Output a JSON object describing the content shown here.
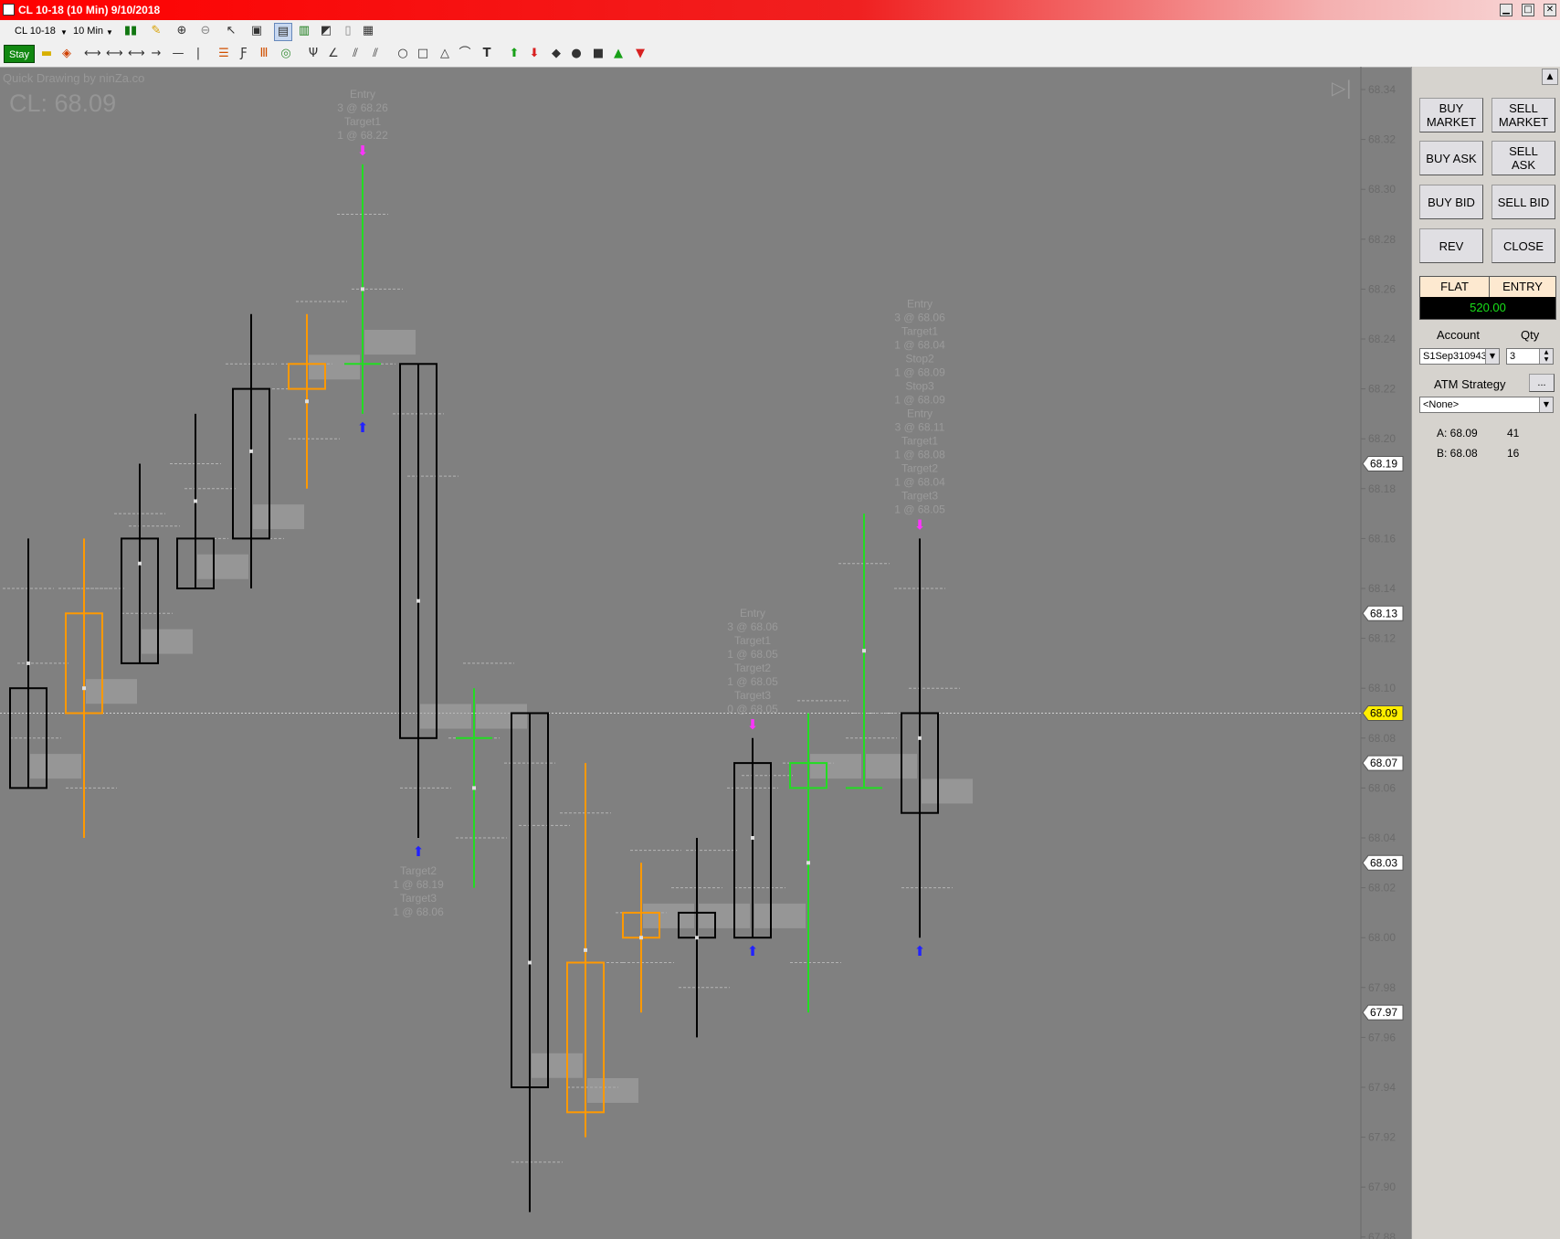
{
  "window": {
    "title": "CL 10-18 (10 Min)  9/10/2018",
    "controls": [
      "minimize",
      "maximize",
      "close"
    ]
  },
  "toolbar": {
    "instrument": "CL 10-18",
    "interval": "10 Min",
    "stay_label": "Stay",
    "icons": [
      "bar-type-icon",
      "pencil-icon",
      "zoom-in-icon",
      "zoom-out-icon",
      "pointer-icon",
      "data-box-icon",
      "chart-trader-icon",
      "indicators-icon",
      "strategies-icon",
      "properties-icon",
      "templates-icon"
    ],
    "drawing_tools": [
      "ruler-icon",
      "risk-reward-icon",
      "ray-icon",
      "extended-line-icon",
      "arrow-line-icon",
      "horizontal-line-icon",
      "vertical-line-icon",
      "fibonacci-retracement-icon",
      "fibonacci-extension-icon",
      "fibonacci-time-icon",
      "fibonacci-circle-icon",
      "andrews-pitchfork-icon",
      "gann-fan-icon",
      "regression-channel-icon",
      "trend-channel-icon",
      "ellipse-icon",
      "rectangle-icon",
      "triangle-icon",
      "arc-icon",
      "text-icon",
      "arrow-up-icon",
      "arrow-down-icon",
      "diamond-icon",
      "dot-icon",
      "square-icon",
      "triangle-up-icon",
      "triangle-down-icon"
    ]
  },
  "chart": {
    "watermark": "Quick Drawing by ninZa.co",
    "symbol_price": "CL: 68.09",
    "axis_ticks": [
      "68.34",
      "68.32",
      "68.30",
      "68.28",
      "68.26",
      "68.24",
      "68.22",
      "68.20",
      "68.18",
      "68.16",
      "68.14",
      "68.12",
      "68.10",
      "68.08",
      "68.06",
      "68.04",
      "68.02",
      "68.00",
      "67.98",
      "67.96",
      "67.94",
      "67.92",
      "67.90",
      "67.88"
    ],
    "price_markers": [
      {
        "value": "68.19",
        "kind": "plain"
      },
      {
        "value": "68.13",
        "kind": "plain"
      },
      {
        "value": "68.09",
        "kind": "last"
      },
      {
        "value": "68.07",
        "kind": "plain"
      },
      {
        "value": "68.03",
        "kind": "plain"
      },
      {
        "value": "67.97",
        "kind": "plain"
      }
    ],
    "last_price": 68.09,
    "candles": [
      {
        "open": 68.06,
        "high": 68.16,
        "low": 68.06,
        "close": 68.1,
        "color": "black"
      },
      {
        "open": 68.09,
        "high": 68.16,
        "low": 68.04,
        "close": 68.13,
        "color": "orange"
      },
      {
        "open": 68.16,
        "high": 68.19,
        "low": 68.11,
        "close": 68.11,
        "color": "black"
      },
      {
        "open": 68.16,
        "high": 68.21,
        "low": 68.14,
        "close": 68.14,
        "color": "black"
      },
      {
        "open": 68.22,
        "high": 68.25,
        "low": 68.14,
        "close": 68.16,
        "color": "black"
      },
      {
        "open": 68.22,
        "high": 68.25,
        "low": 68.18,
        "close": 68.23,
        "color": "orange"
      },
      {
        "open": 68.23,
        "high": 68.31,
        "low": 68.21,
        "close": 68.23,
        "color": "green"
      },
      {
        "open": 68.23,
        "high": 68.23,
        "low": 68.04,
        "close": 68.08,
        "color": "black"
      },
      {
        "open": 68.08,
        "high": 68.1,
        "low": 68.02,
        "close": 68.08,
        "color": "green"
      },
      {
        "open": 68.09,
        "high": 68.09,
        "low": 67.89,
        "close": 67.94,
        "color": "black"
      },
      {
        "open": 67.93,
        "high": 68.07,
        "low": 67.92,
        "close": 67.99,
        "color": "orange"
      },
      {
        "open": 68.0,
        "high": 68.03,
        "low": 67.97,
        "close": 68.01,
        "color": "orange"
      },
      {
        "open": 68.01,
        "high": 68.04,
        "low": 67.96,
        "close": 68.0,
        "color": "black"
      },
      {
        "open": 68.07,
        "high": 68.08,
        "low": 68.0,
        "close": 68.0,
        "color": "black"
      },
      {
        "open": 68.06,
        "high": 68.09,
        "low": 67.97,
        "close": 68.07,
        "color": "green"
      },
      {
        "open": 68.06,
        "high": 68.17,
        "low": 68.06,
        "close": 68.06,
        "color": "green"
      },
      {
        "open": 68.09,
        "high": 68.16,
        "low": 68.0,
        "close": 68.05,
        "color": "black"
      }
    ],
    "annotations": [
      {
        "bar": 6,
        "pos": "above",
        "lines": [
          "Entry",
          "3 @ 68.26",
          "Target1",
          "1 @ 68.22"
        ]
      },
      {
        "bar": 7,
        "pos": "below",
        "lines": [
          "Target2",
          "1 @ 68.19",
          "Target3",
          "1 @ 68.06"
        ]
      },
      {
        "bar": 13,
        "pos": "above",
        "lines": [
          "Entry",
          "3 @ 68.06",
          "Target1",
          "1 @ 68.05",
          "Target2",
          "1 @ 68.05",
          "Target3",
          "0 @ 68.05"
        ]
      },
      {
        "bar": 16,
        "pos": "above",
        "lines": [
          "Entry",
          "3 @ 68.06",
          "Target1",
          "1 @ 68.04",
          "Stop2",
          "1 @ 68.09",
          "Stop3",
          "1 @ 68.09",
          "Entry",
          "3 @ 68.11",
          "Target1",
          "1 @ 68.08",
          "Target2",
          "1 @ 68.04",
          "Target3",
          "1 @ 68.05"
        ]
      }
    ]
  },
  "panel": {
    "buttons": {
      "buy_market": "BUY\nMARKET",
      "sell_market": "SELL\nMARKET",
      "buy_ask": "BUY ASK",
      "sell_ask": "SELL\nASK",
      "buy_bid": "BUY BID",
      "sell_bid": "SELL BID",
      "rev": "REV",
      "close": "CLOSE"
    },
    "position": "FLAT",
    "entry_label": "ENTRY",
    "pnl": "520.00",
    "account_label": "Account",
    "qty_label": "Qty",
    "account_value": "S1Sep310943",
    "qty_value": "3",
    "atm_label": "ATM Strategy",
    "atm_more": "...",
    "atm_value": "<None>",
    "ask_label": "A: 68.09",
    "ask_size": "41",
    "bid_label": "B: 68.08",
    "bid_size": "16"
  }
}
